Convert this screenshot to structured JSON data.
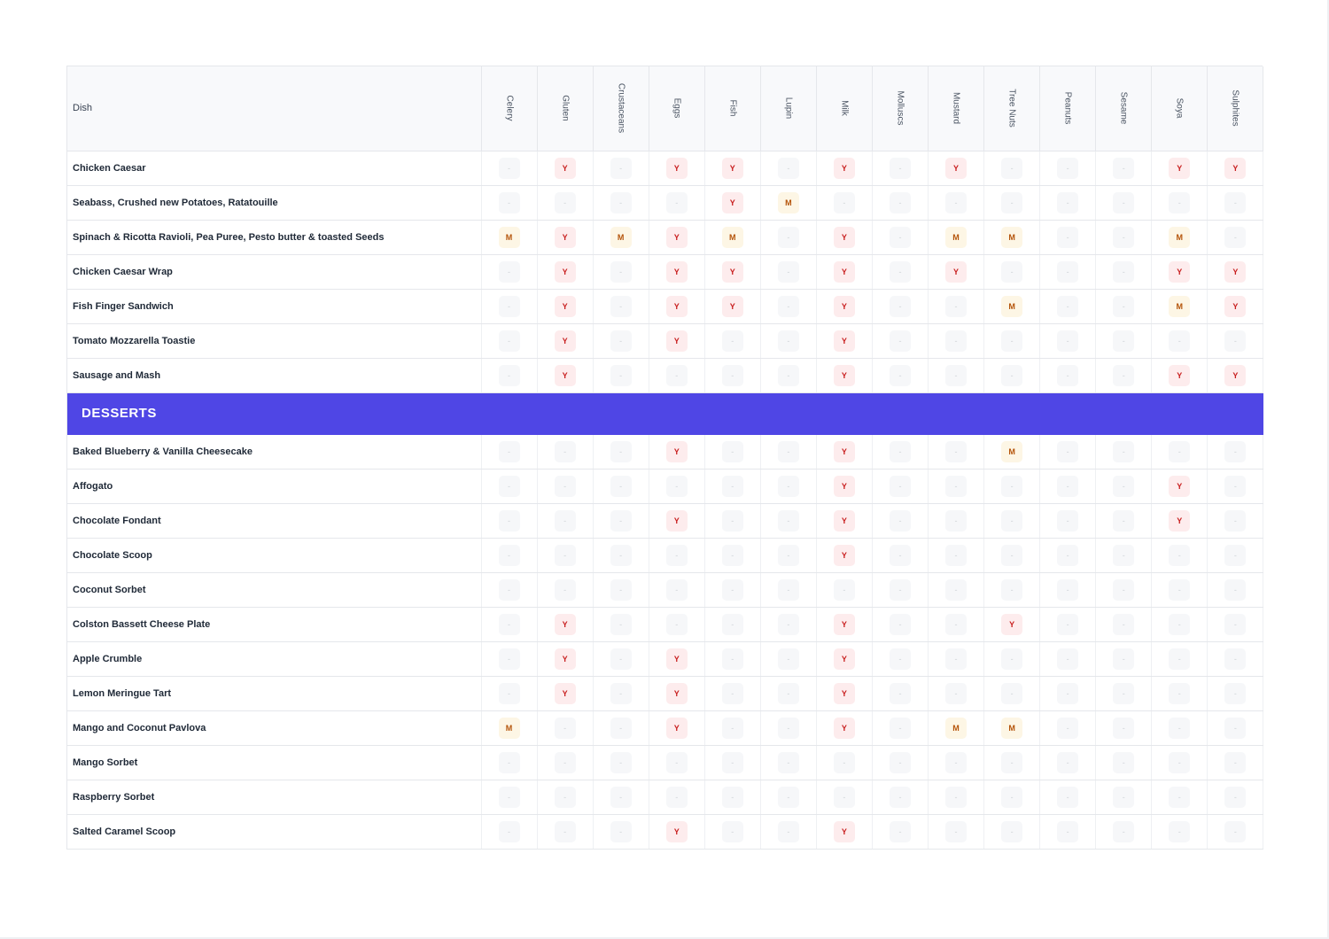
{
  "table": {
    "dish_header": "Dish",
    "allergens": [
      "Celery",
      "Gluten",
      "Crustaceans",
      "Eggs",
      "Fish",
      "Lupin",
      "Milk",
      "Molluscs",
      "Mustard",
      "Tree Nuts",
      "Peanuts",
      "Sesame",
      "Soya",
      "Sulphites"
    ],
    "legend_codes": {
      "Y": "Y",
      "M": "M",
      "N": "-"
    },
    "badge_colors": {
      "Y": "#c81e1e",
      "M": "#b45309",
      "N": "#cfd3d8",
      "section": "#4f46e5"
    },
    "sections": [
      {
        "title": "",
        "rows": [
          {
            "dish": "Chicken Caesar",
            "codes": [
              "N",
              "Y",
              "N",
              "Y",
              "Y",
              "N",
              "Y",
              "N",
              "Y",
              "N",
              "N",
              "N",
              "Y",
              "Y"
            ]
          },
          {
            "dish": "Seabass, Crushed new Potatoes, Ratatouille",
            "codes": [
              "N",
              "N",
              "N",
              "N",
              "Y",
              "M",
              "N",
              "N",
              "N",
              "N",
              "N",
              "N",
              "N",
              "N"
            ]
          },
          {
            "dish": "Spinach & Ricotta Ravioli, Pea Puree, Pesto butter & toasted Seeds",
            "codes": [
              "M",
              "Y",
              "M",
              "Y",
              "M",
              "N",
              "Y",
              "N",
              "M",
              "M",
              "N",
              "N",
              "M",
              "N"
            ]
          },
          {
            "dish": "Chicken Caesar Wrap",
            "codes": [
              "N",
              "Y",
              "N",
              "Y",
              "Y",
              "N",
              "Y",
              "N",
              "Y",
              "N",
              "N",
              "N",
              "Y",
              "Y"
            ]
          },
          {
            "dish": "Fish Finger Sandwich",
            "codes": [
              "N",
              "Y",
              "N",
              "Y",
              "Y",
              "N",
              "Y",
              "N",
              "N",
              "M",
              "N",
              "N",
              "M",
              "Y"
            ]
          },
          {
            "dish": "Tomato Mozzarella Toastie",
            "codes": [
              "N",
              "Y",
              "N",
              "Y",
              "N",
              "N",
              "Y",
              "N",
              "N",
              "N",
              "N",
              "N",
              "N",
              "N"
            ]
          },
          {
            "dish": "Sausage and Mash",
            "codes": [
              "N",
              "Y",
              "N",
              "N",
              "N",
              "N",
              "Y",
              "N",
              "N",
              "N",
              "N",
              "N",
              "Y",
              "Y"
            ]
          }
        ]
      },
      {
        "title": "DESSERTS",
        "rows": [
          {
            "dish": "Baked Blueberry & Vanilla Cheesecake",
            "codes": [
              "N",
              "N",
              "N",
              "Y",
              "N",
              "N",
              "Y",
              "N",
              "N",
              "M",
              "N",
              "N",
              "N",
              "N"
            ]
          },
          {
            "dish": "Affogato",
            "codes": [
              "N",
              "N",
              "N",
              "N",
              "N",
              "N",
              "Y",
              "N",
              "N",
              "N",
              "N",
              "N",
              "Y",
              "N"
            ]
          },
          {
            "dish": "Chocolate Fondant",
            "codes": [
              "N",
              "N",
              "N",
              "Y",
              "N",
              "N",
              "Y",
              "N",
              "N",
              "N",
              "N",
              "N",
              "Y",
              "N"
            ]
          },
          {
            "dish": "Chocolate Scoop",
            "codes": [
              "N",
              "N",
              "N",
              "N",
              "N",
              "N",
              "Y",
              "N",
              "N",
              "N",
              "N",
              "N",
              "N",
              "N"
            ]
          },
          {
            "dish": "Coconut Sorbet",
            "codes": [
              "N",
              "N",
              "N",
              "N",
              "N",
              "N",
              "N",
              "N",
              "N",
              "N",
              "N",
              "N",
              "N",
              "N"
            ]
          },
          {
            "dish": "Colston Bassett Cheese Plate",
            "codes": [
              "N",
              "Y",
              "N",
              "N",
              "N",
              "N",
              "Y",
              "N",
              "N",
              "Y",
              "N",
              "N",
              "N",
              "N"
            ]
          },
          {
            "dish": "Apple Crumble",
            "codes": [
              "N",
              "Y",
              "N",
              "Y",
              "N",
              "N",
              "Y",
              "N",
              "N",
              "N",
              "N",
              "N",
              "N",
              "N"
            ]
          },
          {
            "dish": "Lemon Meringue Tart",
            "codes": [
              "N",
              "Y",
              "N",
              "Y",
              "N",
              "N",
              "Y",
              "N",
              "N",
              "N",
              "N",
              "N",
              "N",
              "N"
            ]
          },
          {
            "dish": "Mango and Coconut Pavlova",
            "codes": [
              "M",
              "N",
              "N",
              "Y",
              "N",
              "N",
              "Y",
              "N",
              "M",
              "M",
              "N",
              "N",
              "N",
              "N"
            ]
          },
          {
            "dish": "Mango Sorbet",
            "codes": [
              "N",
              "N",
              "N",
              "N",
              "N",
              "N",
              "N",
              "N",
              "N",
              "N",
              "N",
              "N",
              "N",
              "N"
            ]
          },
          {
            "dish": "Raspberry Sorbet",
            "codes": [
              "N",
              "N",
              "N",
              "N",
              "N",
              "N",
              "N",
              "N",
              "N",
              "N",
              "N",
              "N",
              "N",
              "N"
            ]
          },
          {
            "dish": "Salted Caramel Scoop",
            "codes": [
              "N",
              "N",
              "N",
              "Y",
              "N",
              "N",
              "Y",
              "N",
              "N",
              "N",
              "N",
              "N",
              "N",
              "N"
            ]
          }
        ]
      }
    ]
  }
}
